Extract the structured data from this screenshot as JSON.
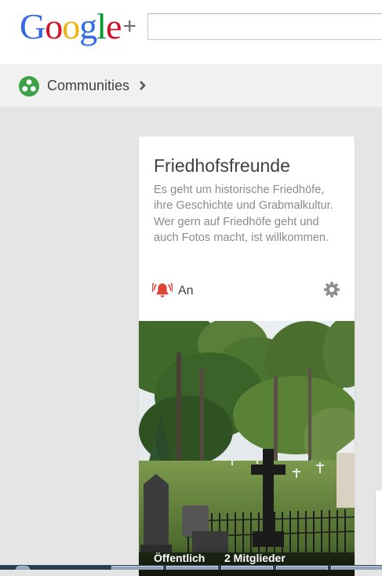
{
  "header": {
    "logo_text": "Google",
    "logo_plus": "+",
    "logo_colors": [
      "#3369e8",
      "#d50f25",
      "#eeb211",
      "#3369e8",
      "#009925",
      "#d50f25"
    ],
    "search": {
      "value": "",
      "placeholder": ""
    }
  },
  "breadcrumb": {
    "icon": "communities-icon",
    "icon_color": "#3ca24a",
    "label": "Communities",
    "chevron": "chevron-right-icon"
  },
  "community": {
    "title": "Friedhofsfreunde",
    "description": "Es geht um historische Friedhöfe, ihre Geschichte und Grabmalkultur. Wer gern auf Friedhöfe geht und auch Fotos macht, ist willkommen.",
    "notifications": {
      "label": "An",
      "icon": "bell-icon",
      "icon_color": "#db4437"
    },
    "settings_icon": "gear-icon",
    "photo": {
      "subject": "cemetery-with-cross-and-trees",
      "visibility": "Öffentlich",
      "members": "2 Mitglieder"
    }
  },
  "colors": {
    "page_background": "#e5e5e5",
    "header_background": "#ffffff",
    "breadcrumb_background": "#f1f1f1",
    "card_background": "#ffffff",
    "title_text": "#404040",
    "description_text": "#8a8a8a"
  }
}
